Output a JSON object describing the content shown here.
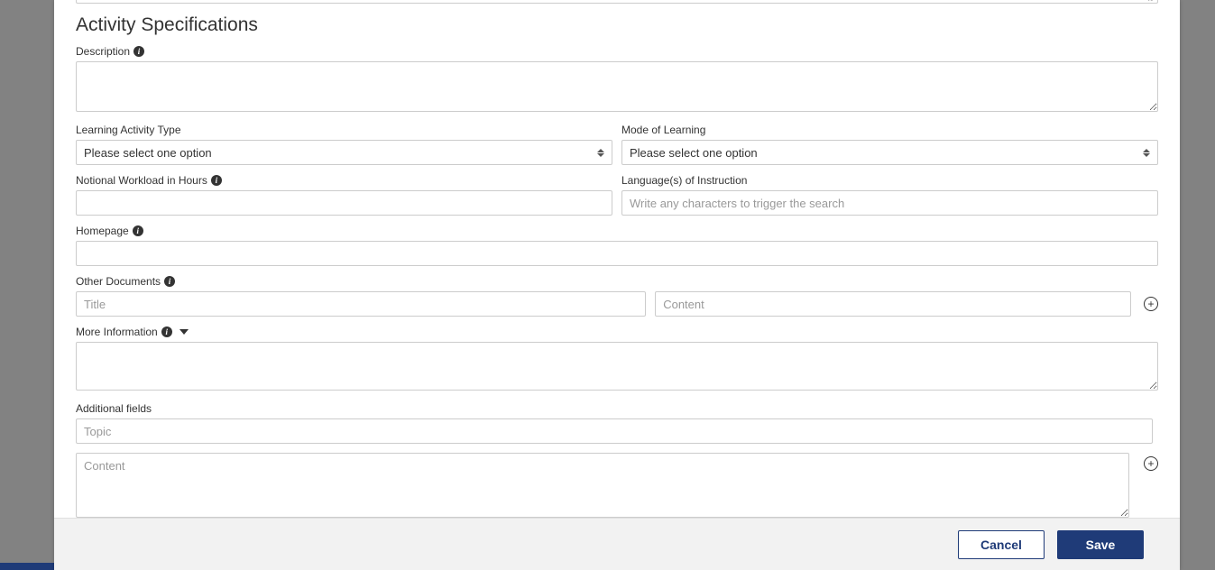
{
  "section": {
    "title": "Activity Specifications"
  },
  "labels": {
    "description": "Description",
    "learningType": "Learning Activity Type",
    "modeOfLearning": "Mode of Learning",
    "notionalWorkload": "Notional Workload in Hours",
    "languages": "Language(s) of Instruction",
    "homepage": "Homepage",
    "otherDocuments": "Other Documents",
    "moreInformation": "More Information",
    "additionalFields": "Additional fields"
  },
  "selects": {
    "learningType": {
      "selected": "Please select one option"
    },
    "modeOfLearning": {
      "selected": "Please select one option"
    }
  },
  "placeholders": {
    "languages": "Write any characters to trigger the search",
    "docTitle": "Title",
    "docContent": "Content",
    "topic": "Topic",
    "addContent": "Content"
  },
  "buttons": {
    "cancel": "Cancel",
    "save": "Save"
  }
}
